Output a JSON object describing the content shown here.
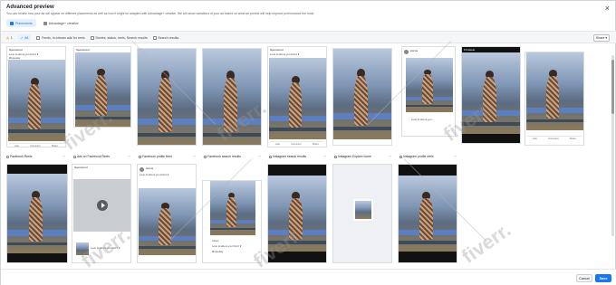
{
  "modal": {
    "title": "Advanced preview",
    "description": "You can review how your ad will appear on different placements as well as how it might be adapted with Advantage+ creative. We will show variations of your ad based on what we predict will help improve performance the most.",
    "close_glyph": "×"
  },
  "tabs": [
    {
      "label": "Placements"
    },
    {
      "label": "Advantage+ creative"
    }
  ],
  "filters": {
    "warning_count": "1",
    "all_label": "All",
    "options": [
      {
        "label": "Feeds, In-stream ads for reels"
      },
      {
        "label": "Stories, status, reels, Search results"
      },
      {
        "label": "Search results"
      }
    ],
    "share_label": "Share"
  },
  "row1_top_text": "Fb Reels",
  "row2_labels": [
    {
      "label": "Facebook Reels"
    },
    {
      "label": "Ads on Facebook Reels"
    },
    {
      "label": "Facebook profile feed"
    },
    {
      "label": "Facebook search results"
    },
    {
      "label": "Instagram search results"
    },
    {
      "label": "Instagram Explore home"
    },
    {
      "label": "Instagram profile reels"
    }
  ],
  "tile_texts": {
    "sponsored": "Sponsored",
    "caption": "Love is where you find it ♥",
    "hashtag": "#hopeday",
    "like": "Like",
    "comment": "Comment",
    "share": "Share",
    "love": "Love is where you ...",
    "account": "Accus"
  },
  "footer": {
    "cancel_label": "Cancel",
    "save_label": "Save"
  },
  "watermark": "fiverr."
}
